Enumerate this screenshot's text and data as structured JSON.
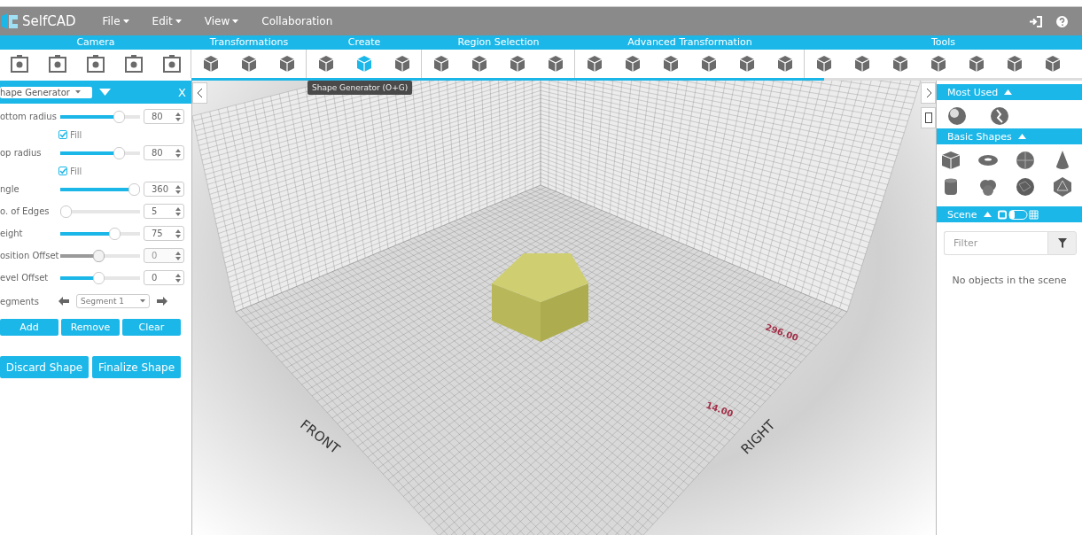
{
  "menu_bar": {
    "logo": "SelfCAD",
    "menus": [
      {
        "label": "File",
        "dropdown": true
      },
      {
        "label": "Edit",
        "dropdown": true
      },
      {
        "label": "View",
        "dropdown": true
      },
      {
        "label": "Collaboration",
        "dropdown": false
      }
    ]
  },
  "toolbar": {
    "groups": [
      {
        "label": "Camera",
        "tools": [
          {
            "selected": false
          },
          {
            "selected": false
          },
          {
            "selected": false
          },
          {
            "selected": false
          },
          {
            "selected": false
          }
        ]
      },
      {
        "label": "Transformations",
        "tools": [
          {
            "selected": false
          },
          {
            "selected": false
          },
          {
            "selected": false
          }
        ]
      },
      {
        "label": "Create",
        "tools": [
          {
            "selected": false
          },
          {
            "selected": true
          },
          {
            "selected": false
          }
        ]
      },
      {
        "label": "Region Selection",
        "tools": [
          {
            "selected": false
          },
          {
            "selected": false
          },
          {
            "selected": false
          },
          {
            "selected": false
          }
        ]
      },
      {
        "label": "Advanced Transformation",
        "tools": [
          {
            "selected": false
          },
          {
            "selected": false
          },
          {
            "selected": false
          },
          {
            "selected": false
          },
          {
            "selected": false
          },
          {
            "selected": false
          }
        ]
      },
      {
        "label": "Tools",
        "tools": [
          {
            "selected": false
          },
          {
            "selected": false
          },
          {
            "selected": false
          },
          {
            "selected": false
          },
          {
            "selected": false
          },
          {
            "selected": false
          },
          {
            "selected": false
          }
        ]
      }
    ],
    "tooltip": "Shape Generator (O+G)",
    "progress": {
      "level": 0.71
    }
  },
  "left_panel": {
    "tool_select": "hape Generator",
    "close_label": "X",
    "params": [
      {
        "kind": "slider",
        "label": "ottom radius",
        "level": 0.78,
        "value": "80",
        "disabled": false
      },
      {
        "kind": "checkbox",
        "label": "Fill",
        "checked": true
      },
      {
        "kind": "slider",
        "label": "op radius",
        "level": 0.78,
        "value": "80",
        "disabled": false
      },
      {
        "kind": "checkbox",
        "label": "Fill",
        "checked": true
      },
      {
        "kind": "slider",
        "label": "ngle",
        "level": 1,
        "value": "360",
        "disabled": false
      },
      {
        "kind": "slider",
        "label": "o. of Edges",
        "level": 0,
        "value": "5",
        "disabled": false
      },
      {
        "kind": "slider",
        "label": "eight",
        "level": 0.72,
        "value": "75",
        "disabled": false
      },
      {
        "kind": "slider",
        "label": "osition Offset",
        "level": 0.48,
        "value": "0",
        "disabled": true
      },
      {
        "kind": "slider",
        "label": "evel Offset",
        "level": 0.48,
        "value": "0",
        "disabled": false
      },
      {
        "kind": "select",
        "label": "egments",
        "value": "Segment 1"
      }
    ],
    "segment_buttons": [
      "Add",
      "Remove",
      "Clear"
    ],
    "shape_buttons": [
      "Discard Shape",
      "Finalize Shape"
    ]
  },
  "viewport": {
    "labels": [
      {
        "kind": "axis",
        "text": "FRONT"
      },
      {
        "kind": "axis",
        "text": "RIGHT"
      },
      {
        "kind": "dimension",
        "text": "296.00"
      },
      {
        "kind": "dimension",
        "text": "14.00"
      }
    ]
  },
  "right_panel": {
    "sections": [
      {
        "title": "Most Used",
        "expanded": true
      },
      {
        "title": "Basic Shapes",
        "expanded": true
      },
      {
        "title": "Scene",
        "expanded": true
      }
    ],
    "filter": {
      "placeholder": "Filter"
    },
    "empty_text": "No objects in the scene"
  }
}
